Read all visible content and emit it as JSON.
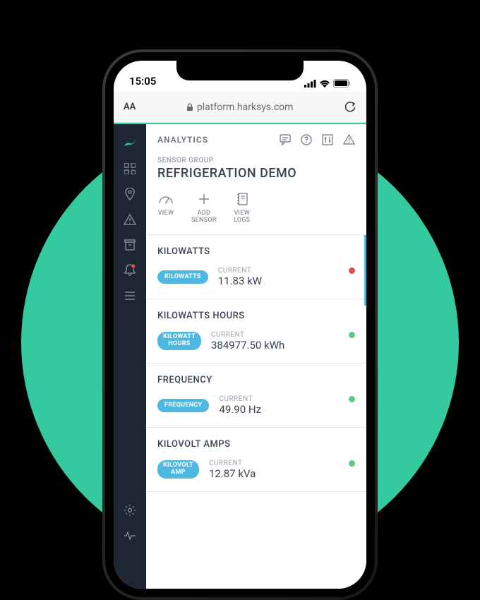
{
  "status": {
    "time": "15:05"
  },
  "browser": {
    "url": "platform.harksys.com"
  },
  "header": {
    "title": "ANALYTICS"
  },
  "group": {
    "label": "SENSOR GROUP",
    "name": "REFRIGERATION DEMO"
  },
  "actions": {
    "view": "VIEW",
    "add": "ADD\nSENSOR",
    "logs": "VIEW\nLOGS"
  },
  "sensors": [
    {
      "title": "KILOWATTS",
      "tag": "KILOWATTS",
      "label": "CURRENT",
      "value": "11.83 kW",
      "status": "red"
    },
    {
      "title": "KILOWATTS HOURS",
      "tag": "KILOWATT\nHOURS",
      "label": "CURRENT",
      "value": "384977.50 kWh",
      "status": "green"
    },
    {
      "title": "FREQUENCY",
      "tag": "FREQUENCY",
      "label": "CURRENT",
      "value": "49.90 Hz",
      "status": "green"
    },
    {
      "title": "KILOVOLT AMPS",
      "tag": "KILOVOLT\nAMP",
      "label": "CURRENT",
      "value": "12.87 kVa",
      "status": "green"
    }
  ]
}
